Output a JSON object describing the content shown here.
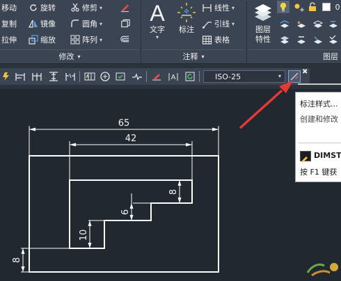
{
  "ribbon": {
    "modify": {
      "move": "移动",
      "rotate": "旋转",
      "trim": "修剪",
      "copy": "复制",
      "mirror": "镜像",
      "fillet": "圆角",
      "stretch": "拉伸",
      "scale": "缩放",
      "array": "阵列",
      "title": "修改"
    },
    "annotation": {
      "text": "文字",
      "dimension": "标注",
      "linear": "线性",
      "leader": "引线",
      "table": "表格",
      "title": "注释"
    },
    "layers": {
      "properties_line1": "图层",
      "properties_line2": "特性",
      "title": "图层"
    }
  },
  "dim_toolbar": {
    "style_combo_value": "ISO-25"
  },
  "tooltip": {
    "title": "标注样式...",
    "description": "创建和修改",
    "command": "DIMST",
    "help": "按 F1 键获"
  },
  "drawing": {
    "dim_65": "65",
    "dim_42": "42",
    "dim_8_top": "8",
    "dim_6": "6",
    "dim_10": "10",
    "dim_8_left": "8"
  },
  "colors": {
    "background": "#212830",
    "ribbon": "#3b4453",
    "line": "#ffffff",
    "arrow_annotation": "#e53935"
  }
}
